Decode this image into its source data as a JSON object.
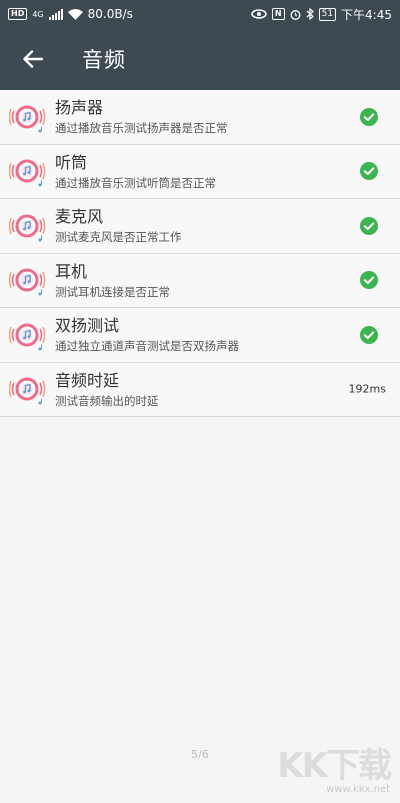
{
  "status_bar": {
    "hd_badge": "HD",
    "network_type": "4G",
    "speed": "80.0B/s",
    "nfc_label": "N",
    "battery_level": "51",
    "time": "下午4:45"
  },
  "app_bar": {
    "title": "音频"
  },
  "items": [
    {
      "title": "扬声器",
      "subtitle": "通过播放音乐测试扬声器是否正常",
      "status": "check"
    },
    {
      "title": "听筒",
      "subtitle": "通过播放音乐测试听筒是否正常",
      "status": "check"
    },
    {
      "title": "麦克风",
      "subtitle": "测试麦克风是否正常工作",
      "status": "check"
    },
    {
      "title": "耳机",
      "subtitle": "测试耳机连接是否正常",
      "status": "check"
    },
    {
      "title": "双扬测试",
      "subtitle": "通过独立通道声音测试是否双扬声器",
      "status": "check"
    },
    {
      "title": "音频时延",
      "subtitle": "测试音频输出的时延",
      "status_text": "192ms"
    }
  ],
  "footer": {
    "page_indicator": "5/6"
  },
  "watermark": {
    "logo": "KK下载",
    "url": "www.kkx.net"
  },
  "colors": {
    "header_bg": "#3d4a52",
    "check_green": "#3cb550",
    "icon_pink": "#f06b8a",
    "icon_blue": "#5a9fd8"
  }
}
